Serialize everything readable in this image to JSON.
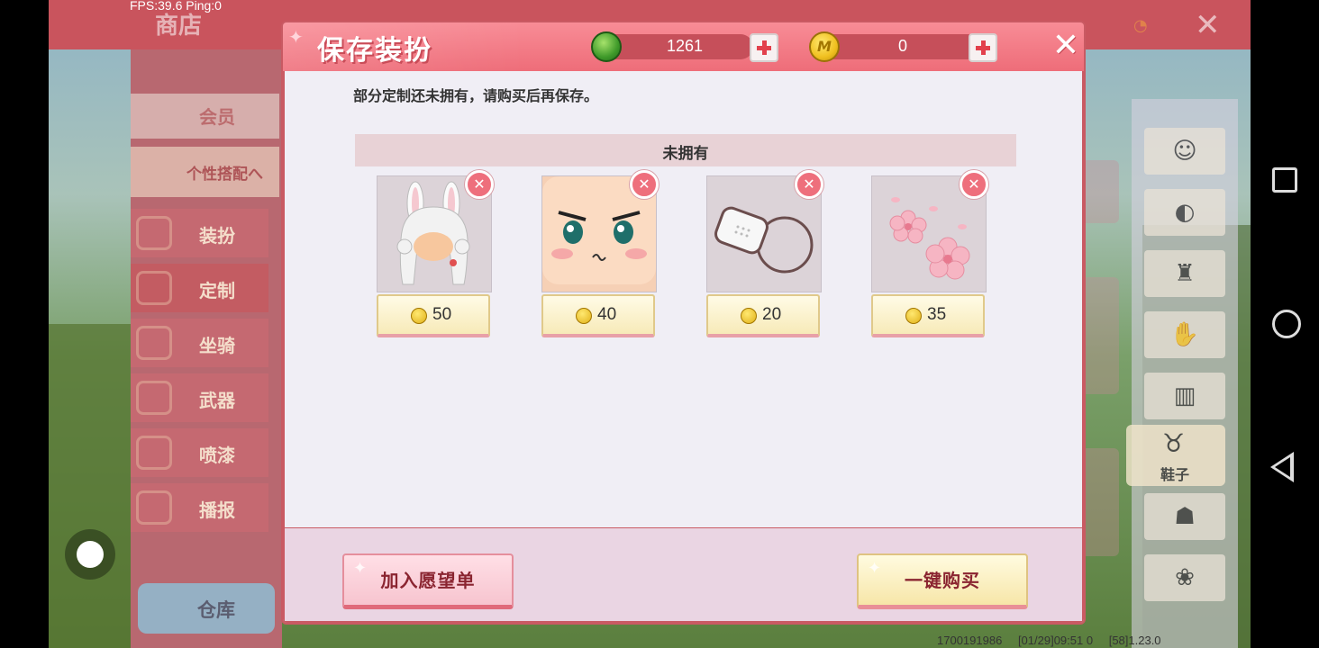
{
  "overlay": {
    "fps_text": "FPS:39.6  Ping:0"
  },
  "shop": {
    "title": "商店",
    "categories": [
      {
        "label": "会员"
      },
      {
        "label": "个性搭配へ"
      },
      {
        "label": "装扮"
      },
      {
        "label": "定制"
      },
      {
        "label": "坐骑"
      },
      {
        "label": "武器"
      },
      {
        "label": "喷漆"
      },
      {
        "label": "播报"
      }
    ],
    "warehouse_label": "仓库",
    "shoes_label": "鞋子"
  },
  "modal": {
    "title": "保存装扮",
    "currency": {
      "gems": "1261",
      "coins": "0",
      "coin_symbol": "M"
    },
    "close_glyph": "✕",
    "notice": "部分定制还未拥有，请购买后再保存。",
    "section_title": "未拥有",
    "items": [
      {
        "name": "bunny-hair",
        "price": "50"
      },
      {
        "name": "angry-face",
        "price": "40"
      },
      {
        "name": "face-mask",
        "price": "20"
      },
      {
        "name": "sakura-decal",
        "price": "35"
      }
    ],
    "wishlist_label": "加入愿望单",
    "buy_all_label": "一键购买"
  },
  "footer": {
    "uid": "1700191986",
    "datetime": "[01/29]09:51 0",
    "version": "[58]1.23.0"
  },
  "colors": {
    "header_pink": "#ee6d79",
    "close_red": "#e2404c",
    "body_bg": "#f0eef5"
  }
}
